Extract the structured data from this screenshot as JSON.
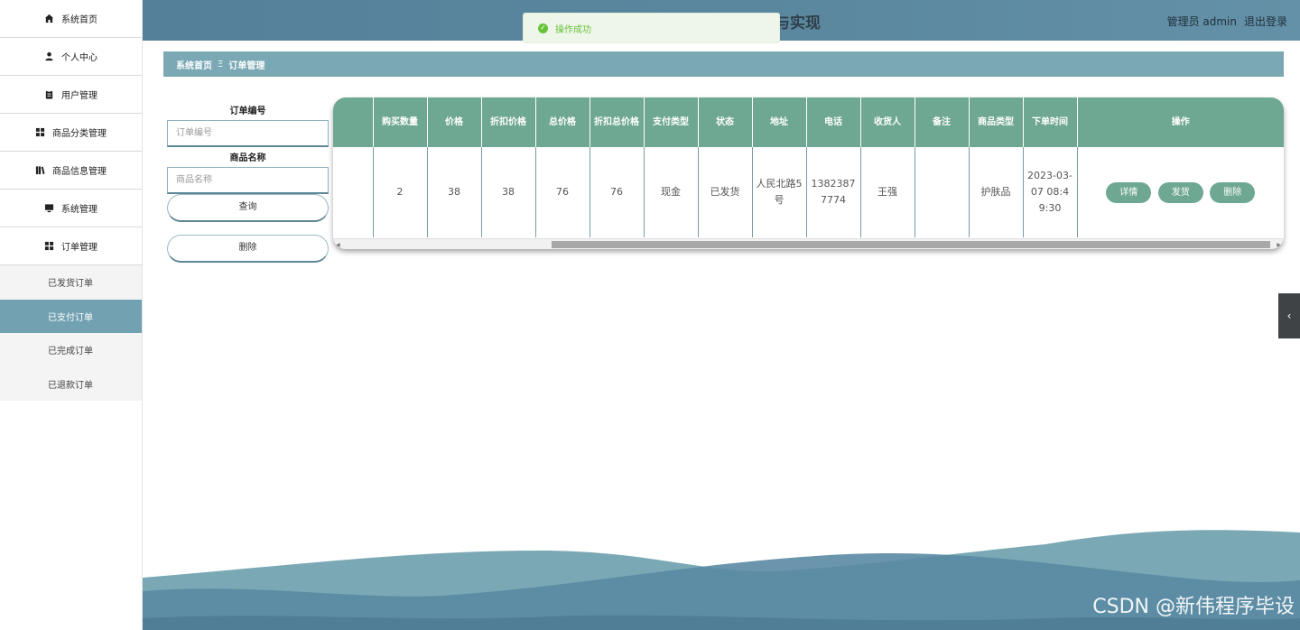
{
  "sidebar": {
    "items": [
      {
        "label": "系统首页",
        "icon": "home-icon"
      },
      {
        "label": "个人中心",
        "icon": "user-icon"
      },
      {
        "label": "用户管理",
        "icon": "clipboard-icon"
      },
      {
        "label": "商品分类管理",
        "icon": "grid-icon"
      },
      {
        "label": "商品信息管理",
        "icon": "book-icon"
      },
      {
        "label": "系统管理",
        "icon": "monitor-icon"
      },
      {
        "label": "订单管理",
        "icon": "grid-icon"
      }
    ],
    "submenu": [
      {
        "label": "已发货订单",
        "active": false
      },
      {
        "label": "已支付订单",
        "active": true
      },
      {
        "label": "已完成订单",
        "active": false
      },
      {
        "label": "已退款订单",
        "active": false
      }
    ]
  },
  "header": {
    "title_visible": "与实现",
    "role": "管理员 admin",
    "logout": "退出登录"
  },
  "toast": {
    "message": "操作成功",
    "icon": "check-circle-icon"
  },
  "breadcrumb": {
    "home": "系统首页",
    "separator": "Ξ",
    "current": "订单管理"
  },
  "search": {
    "order_no_label": "订单编号",
    "order_no_placeholder": "订单编号",
    "product_name_label": "商品名称",
    "product_name_placeholder": "商品名称",
    "query_button": "查询",
    "delete_button": "删除"
  },
  "table": {
    "columns": [
      "",
      "购买数量",
      "价格",
      "折扣价格",
      "总价格",
      "折扣总价格",
      "支付类型",
      "状态",
      "地址",
      "电话",
      "收货人",
      "备注",
      "商品类型",
      "下单时间",
      "操作"
    ],
    "rows": [
      {
        "cells": [
          "",
          "2",
          "38",
          "38",
          "76",
          "76",
          "现金",
          "已发货",
          "人民北路5号",
          "13823877774",
          "王强",
          "",
          "护肤品",
          "2023-03-07 08:49:30"
        ],
        "actions": [
          "详情",
          "发货",
          "删除"
        ]
      }
    ]
  },
  "colors": {
    "accent": "#6fa892",
    "header": "#5b889f",
    "breadcrumb": "#7aa9b5",
    "active_submenu": "#72a2b2",
    "success": "#67c23a"
  },
  "side_toggle_icon": "chevron-left-icon",
  "watermark": "CSDN @新伟程序毕设"
}
